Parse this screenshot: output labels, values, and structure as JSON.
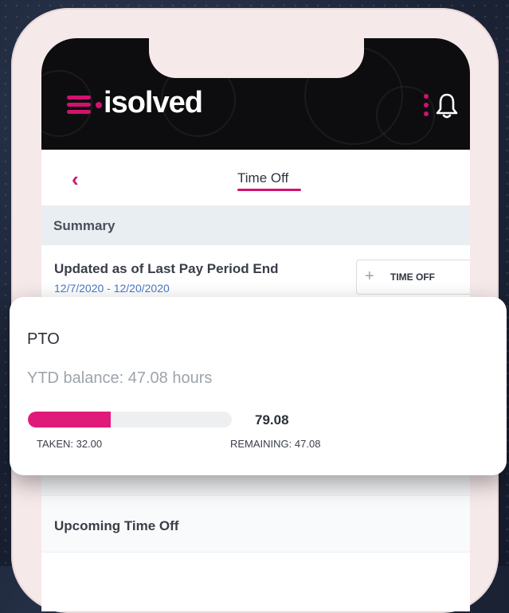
{
  "app": {
    "brand": "isolved"
  },
  "nav": {
    "title": "Time Off"
  },
  "summary": {
    "heading": "Summary",
    "updated_label": "Updated as of Last Pay Period End",
    "date_range": "12/7/2020 - 12/20/2020",
    "time_off_button": "TIME OFF"
  },
  "pto_card": {
    "title": "PTO",
    "balance": "YTD balance: 47.08 hours",
    "total": "79.08",
    "taken_label": "TAKEN: 32.00",
    "remaining_label": "REMAINING: 47.08",
    "taken_value": 32.0,
    "total_value": 79.08
  },
  "upcoming": {
    "heading": "Upcoming Time Off"
  },
  "colors": {
    "accent": "#e01a7a",
    "header_bg": "#0d0d0f",
    "link": "#4a79c7"
  },
  "icons": {
    "menu": "hamburger-menu-icon",
    "more": "kebab-menu-icon",
    "notifications": "bell-icon",
    "back": "chevron-left-icon",
    "add": "plus-icon"
  }
}
